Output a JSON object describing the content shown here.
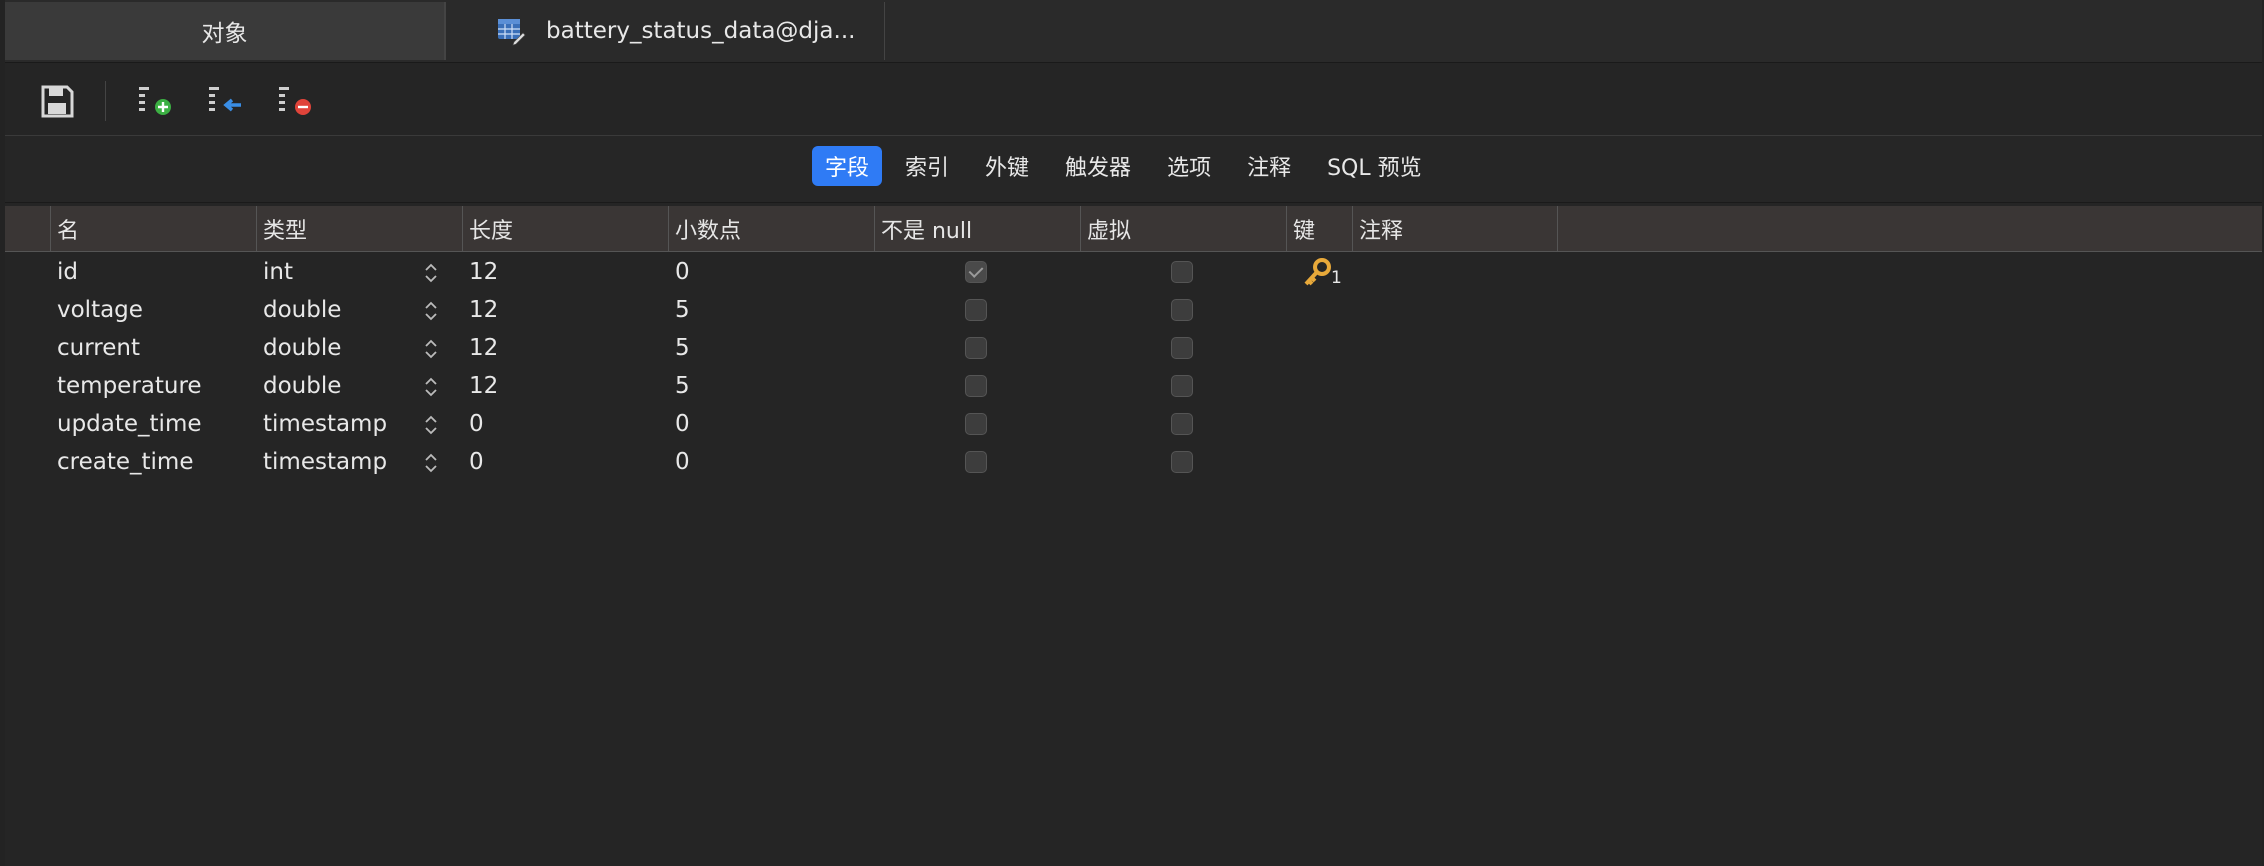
{
  "tabs": {
    "objects_label": "对象",
    "active_label": "battery_status_data@dja..."
  },
  "toolbar": {
    "save_icon": "save-icon",
    "add_field_icon": "add-field-icon",
    "insert_field_icon": "insert-field-icon",
    "delete_field_icon": "delete-field-icon"
  },
  "segments": {
    "fields": "字段",
    "indexes": "索引",
    "foreign_keys": "外键",
    "triggers": "触发器",
    "options": "选项",
    "comments": "注释",
    "sql_preview": "SQL 预览"
  },
  "columns": {
    "name": "名",
    "type": "类型",
    "length": "长度",
    "decimals": "小数点",
    "not_null": "不是 null",
    "virtual": "虚拟",
    "key": "键",
    "comment": "注释"
  },
  "rows": [
    {
      "name": "id",
      "type": "int",
      "length": "12",
      "decimals": "0",
      "not_null": true,
      "virtual": false,
      "key": "1"
    },
    {
      "name": "voltage",
      "type": "double",
      "length": "12",
      "decimals": "5",
      "not_null": false,
      "virtual": false,
      "key": ""
    },
    {
      "name": "current",
      "type": "double",
      "length": "12",
      "decimals": "5",
      "not_null": false,
      "virtual": false,
      "key": ""
    },
    {
      "name": "temperature",
      "type": "double",
      "length": "12",
      "decimals": "5",
      "not_null": false,
      "virtual": false,
      "key": ""
    },
    {
      "name": "update_time",
      "type": "timestamp",
      "length": "0",
      "decimals": "0",
      "not_null": false,
      "virtual": false,
      "key": ""
    },
    {
      "name": "create_time",
      "type": "timestamp",
      "length": "0",
      "decimals": "0",
      "not_null": false,
      "virtual": false,
      "key": ""
    }
  ],
  "colors": {
    "accent": "#2f7bf5",
    "key_icon": "#e8a93a",
    "add_green": "#3cb043",
    "delete_red": "#e0443a",
    "insert_blue": "#3a8ee6"
  }
}
